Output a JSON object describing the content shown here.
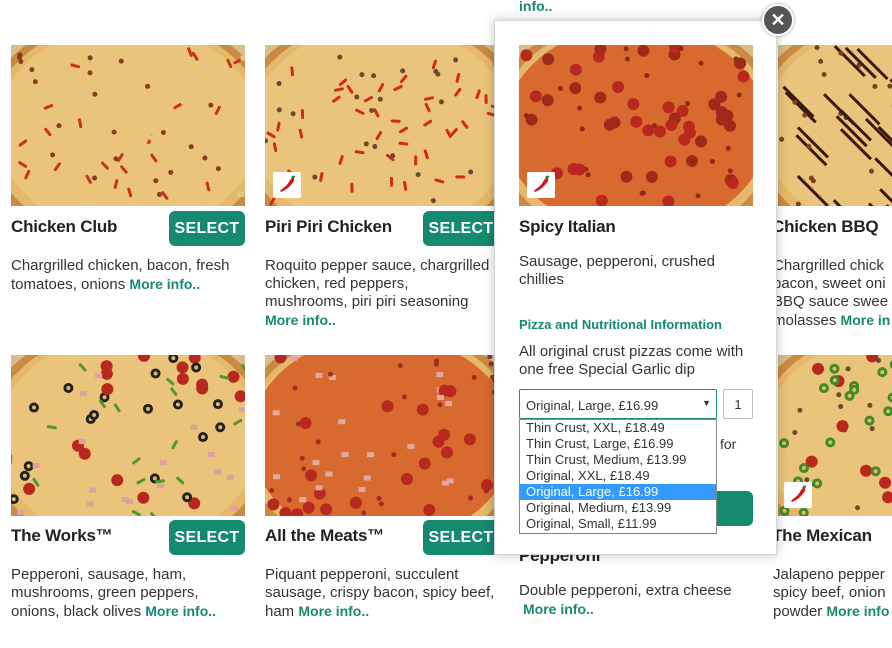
{
  "top_link": "info..",
  "colors": {
    "accent": "#168a6f",
    "selected_option": "#3399ff"
  },
  "cards": [
    {
      "name": "Chicken Club",
      "select": "SELECT",
      "desc": "Chargrilled chicken, bacon, fresh tomatoes, onions",
      "more": "More info..",
      "spicy": false
    },
    {
      "name": "Piri Piri Chicken",
      "select": "SELECT",
      "desc": "Roquito pepper sauce, chargrilled chicken, red peppers, mushrooms, piri piri seasoning",
      "more": "More info..",
      "spicy": true
    },
    {
      "name": "Chicken BBQ",
      "select": "",
      "desc": "Chargrilled chick bacon, sweet oni BBQ sauce swee molasses",
      "more": "More in",
      "spicy": false
    },
    {
      "name": "The Works™",
      "select": "SELECT",
      "desc": "Pepperoni, sausage, ham, mushrooms, green peppers, onions, black olives",
      "more": "More info..",
      "spicy": false
    },
    {
      "name": "All the Meats™",
      "select": "SELECT",
      "desc": "Piquant pepperoni, succulent sausage, crispy bacon, spicy beef, ham",
      "more": "More info..",
      "spicy": false
    },
    {
      "name": "Pepperoni",
      "select": "",
      "desc": "Double pepperoni, extra cheese",
      "more": "More info..",
      "spicy": false
    },
    {
      "name": "The Mexican",
      "select": "",
      "desc": "Jalapeno pepper spicy beef, onion powder",
      "more": "More info",
      "spicy": true
    }
  ],
  "popup": {
    "name": "Spicy Italian",
    "desc": "Sausage, pepperoni, crushed chillies",
    "nutri_link": "Pizza and Nutritional Information",
    "crust_note": "All original crust pizzas come with one free Special Garlic dip",
    "selected_size": "Original, Large, £16.99",
    "quantity": "1",
    "peek_for": "for",
    "options": [
      "Thin Crust, XXL, £18.49",
      "Thin Crust, Large, £16.99",
      "Thin Crust, Medium, £13.99",
      "Original, XXL, £18.49",
      "Original, Large, £16.99",
      "Original, Medium, £13.99",
      "Original, Small, £11.99"
    ],
    "selected_index": 4,
    "close": "✕"
  }
}
